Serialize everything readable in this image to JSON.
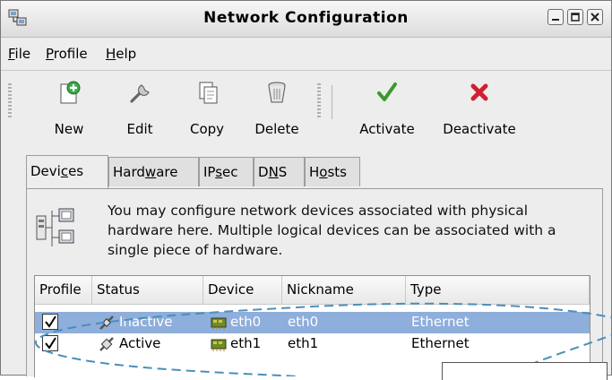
{
  "window": {
    "title": "Network Configuration",
    "icon": "network-config-icon",
    "controls": [
      "minimize-icon",
      "maximize-icon",
      "close-icon"
    ]
  },
  "menu": {
    "items": [
      {
        "label": "File",
        "mnemonic": "F",
        "rest": "ile"
      },
      {
        "label": "Profile",
        "mnemonic": "P",
        "rest": "rofile"
      },
      {
        "label": "Help",
        "mnemonic": "H",
        "rest": "elp"
      }
    ]
  },
  "toolbar": {
    "buttons": [
      {
        "label": "New",
        "icon": "new-icon"
      },
      {
        "label": "Edit",
        "icon": "wrench-icon"
      },
      {
        "label": "Copy",
        "icon": "copy-icon"
      },
      {
        "label": "Delete",
        "icon": "trash-icon"
      },
      {
        "label": "Activate",
        "icon": "checkmark-icon"
      },
      {
        "label": "Deactivate",
        "icon": "x-icon"
      }
    ]
  },
  "tabs": [
    {
      "label": "Devices",
      "pre": "Devi",
      "mnemonic": "c",
      "post": "es",
      "active": true
    },
    {
      "label": "Hardware",
      "pre": "Hard",
      "mnemonic": "w",
      "post": "are",
      "active": false
    },
    {
      "label": "IPsec",
      "pre": "IP",
      "mnemonic": "s",
      "post": "ec",
      "active": false
    },
    {
      "label": "DNS",
      "pre": "D",
      "mnemonic": "N",
      "post": "S",
      "active": false
    },
    {
      "label": "Hosts",
      "pre": "H",
      "mnemonic": "o",
      "post": "sts",
      "active": false
    }
  ],
  "info": {
    "text": "You may configure network devices associated with physical hardware here.  Multiple logical devices can be associated with a single piece of hardware.",
    "icon": "network-devices-icon"
  },
  "device_list": {
    "columns": [
      "Profile",
      "Status",
      "Device",
      "Nickname",
      "Type"
    ],
    "rows": [
      {
        "profile_checked": true,
        "status": "Inactive",
        "device": "eth0",
        "nickname": "eth0",
        "type": "Ethernet",
        "selected": true
      },
      {
        "profile_checked": true,
        "status": "Active",
        "device": "eth1",
        "nickname": "eth1",
        "type": "Ethernet",
        "selected": false
      }
    ]
  },
  "colors": {
    "selection": "#8eaedb",
    "activate_green": "#3a9a2a",
    "deactivate_red": "#d02030",
    "annotation_dash": "#4a8fb8"
  }
}
